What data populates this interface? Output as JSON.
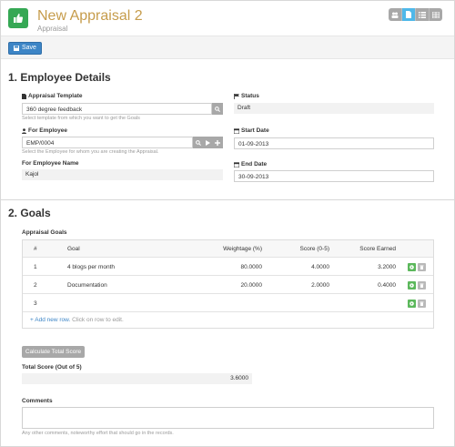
{
  "header": {
    "title": "New Appraisal 2",
    "subtitle": "Appraisal"
  },
  "toolbar": {
    "save_label": "Save"
  },
  "section1": {
    "title": "1. Employee Details",
    "appraisal_template": {
      "label": "Appraisal Template",
      "value": "360 degree feedback",
      "help": "Select template from which you want to get the Goals"
    },
    "for_employee": {
      "label": "For Employee",
      "value": "EMP/0004",
      "help": "Select the Employee for whom you are creating the Appraisal."
    },
    "for_employee_name": {
      "label": "For Employee Name",
      "value": "Kajol"
    },
    "status": {
      "label": "Status",
      "value": "Draft"
    },
    "start_date": {
      "label": "Start Date",
      "value": "01-09-2013"
    },
    "end_date": {
      "label": "End Date",
      "value": "30-09-2013"
    }
  },
  "section2": {
    "title": "2. Goals",
    "grid_label": "Appraisal Goals",
    "columns": [
      "#",
      "Goal",
      "Weightage (%)",
      "Score (0-5)",
      "Score Earned"
    ],
    "rows": [
      {
        "idx": "1",
        "goal": "4 blogs per month",
        "weightage": "80.0000",
        "score": "4.0000",
        "earned": "3.2000"
      },
      {
        "idx": "2",
        "goal": "Documentation",
        "weightage": "20.0000",
        "score": "2.0000",
        "earned": "0.4000"
      },
      {
        "idx": "3",
        "goal": "",
        "weightage": "",
        "score": "",
        "earned": ""
      }
    ],
    "add_new_row": "+ Add new row.",
    "add_new_row_hint": "Click on row to edit.",
    "calc_button": "Calculate Total Score",
    "total_score_label": "Total Score (Out of 5)",
    "total_score_value": "3.6000",
    "comments_label": "Comments",
    "comments_help": "Any other comments, noteworthy effort that should go in the records."
  },
  "colors": {
    "title": "#c69c4b",
    "primary": "#3d85c6",
    "success": "#5cb85c",
    "app_icon": "#35a854"
  },
  "icons": {
    "app": "thumbs-up-icon",
    "search": "search-icon",
    "play": "play-icon",
    "plus": "plus-icon",
    "calendar": "calendar-icon",
    "flag": "flag-icon",
    "user": "user-icon",
    "file": "file-icon"
  }
}
